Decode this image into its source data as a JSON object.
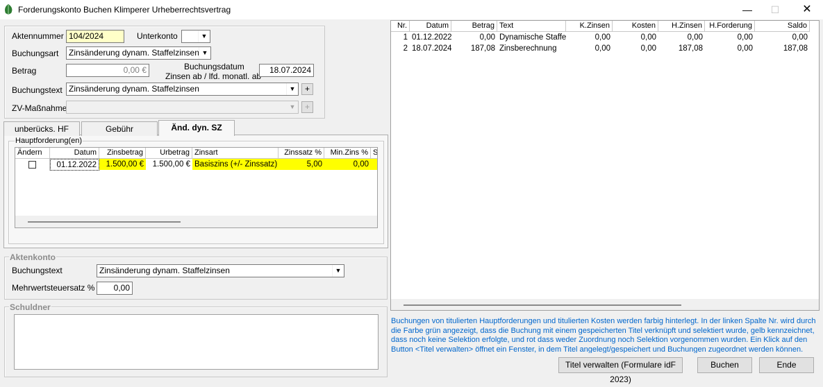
{
  "window": {
    "title": "Forderungskonto Buchen Klimperer Urheberrechtsvertrag",
    "minimize": "—",
    "maximize": "☐",
    "close": "✕"
  },
  "form": {
    "aktennummer_label": "Aktennummer",
    "aktennummer_value": "104/2024",
    "unterkonto_label": "Unterkonto",
    "unterkonto_value": "",
    "buchungsart_label": "Buchungsart",
    "buchungsart_value": "Zinsänderung dynam. Staffelzinsen",
    "betrag_label": "Betrag",
    "betrag_value": "0,00 €",
    "buchungsdatum_label": "Buchungsdatum",
    "zinsen_ab_label": "Zinsen ab / lfd. monatl. ab",
    "buchungsdatum_value": "18.07.2024",
    "buchungstext_label": "Buchungstext",
    "buchungstext_value": "Zinsänderung dynam. Staffelzinsen",
    "plus": "+",
    "zv_label": "ZV-Maßnahme",
    "zv_value": ""
  },
  "tabs": [
    {
      "label": "unberücks. HF"
    },
    {
      "label": "Gebühr"
    },
    {
      "label": "Änd. dyn. SZ"
    }
  ],
  "hauptforderung": {
    "legend": "Hauptforderung(en)",
    "columns": [
      "Ändern",
      "Datum",
      "Zinsbetrag",
      "Urbetrag",
      "Zinsart",
      "Zinssatz %",
      "Min.Zins %",
      "S"
    ],
    "rows": [
      {
        "aendern": false,
        "datum": "01.12.2022",
        "zinsbetrag": "1.500,00 €",
        "urbetrag": "1.500,00 €",
        "zinsart": "Basiszins (+/- Zinssatz)",
        "zinssatz": "5,00",
        "minzins": "0,00"
      }
    ]
  },
  "aktenkonto": {
    "legend": "Aktenkonto",
    "buchungstext_label": "Buchungstext",
    "buchungstext_value": "Zinsänderung dynam. Staffelzinsen",
    "mwst_label": "Mehrwertsteuersatz %",
    "mwst_value": "0,00"
  },
  "schuldner": {
    "legend": "Schuldner"
  },
  "bookings": {
    "columns": [
      "Nr.",
      "Datum",
      "Betrag",
      "Text",
      "K.Zinsen",
      "Kosten",
      "H.Zinsen",
      "H.Forderung",
      "Saldo"
    ],
    "rows": [
      {
        "nr": "1",
        "datum": "01.12.2022",
        "betrag": "0,00",
        "text": "Dynamische Staffelz",
        "kzinsen": "0,00",
        "kosten": "0,00",
        "hzinsen": "0,00",
        "hforderung": "0,00",
        "saldo": "0,00"
      },
      {
        "nr": "2",
        "datum": "18.07.2024",
        "betrag": "187,08",
        "text": "Zinsberechnung",
        "kzinsen": "0,00",
        "kosten": "0,00",
        "hzinsen": "187,08",
        "hforderung": "0,00",
        "saldo": "187,08"
      }
    ]
  },
  "info_text": "Buchungen von titulierten Hauptforderungen und titulierten Kosten werden farbig hinterlegt. In der linken Spalte Nr. wird durch die Farbe grün angezeigt, dass die Buchung mit einem gespeicherten Titel verknüpft und selektiert wurde, gelb kennzeichnet, dass noch keine Selektion erfolgte, und rot dass weder Zuordnung noch Selektion vorgenommen wurden. Ein Klick auf den Button <Titel verwalten> öffnet ein Fenster, in dem Titel angelegt/gespeichert und Buchungen zugeordnet werden können.",
  "buttons": {
    "titel": "Titel verwalten (Formulare idF 2023)",
    "buchen": "Buchen",
    "ende": "Ende"
  },
  "colors": {
    "highlight_yellow": "#ffff00",
    "field_yellow": "#ffffc8",
    "info_blue": "#0066cc"
  }
}
